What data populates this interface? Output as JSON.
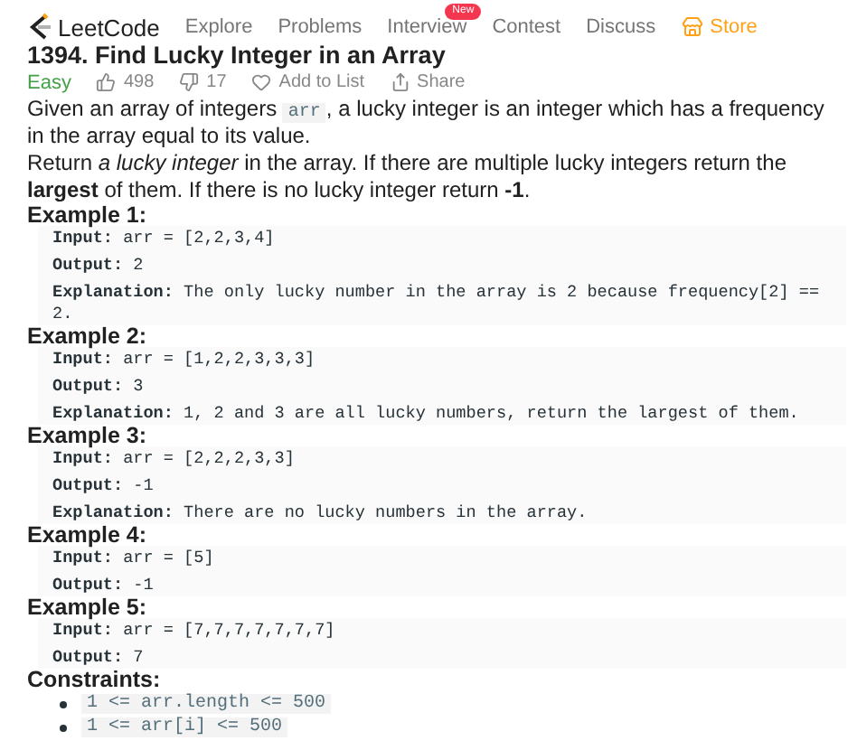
{
  "nav": {
    "logo": "LeetCode",
    "items": [
      {
        "label": "Explore",
        "kind": "link"
      },
      {
        "label": "Problems",
        "kind": "link"
      },
      {
        "label": "Interview",
        "kind": "link",
        "badge": "New"
      },
      {
        "label": "Contest",
        "kind": "link"
      },
      {
        "label": "Discuss",
        "kind": "link"
      },
      {
        "label": "Store",
        "kind": "store"
      }
    ]
  },
  "problem": {
    "title": "1394. Find Lucky Integer in an Array",
    "difficulty": "Easy",
    "likes": "498",
    "dislikes": "17",
    "add_to_list": "Add to List",
    "share": "Share"
  },
  "description": [
    [
      {
        "kind": "text",
        "text": "Given an array of integers "
      },
      {
        "kind": "code",
        "text": "arr"
      },
      {
        "kind": "text",
        "text": ", a lucky integer is an integer which has a frequency in the array equal to its value."
      }
    ],
    [
      {
        "kind": "text",
        "text": "Return *a lucky integer* in the array. If there are multiple lucky integers return the **largest** of them. If there is no lucky integer return **-1**."
      }
    ]
  ],
  "examples": [
    {
      "heading": "Example 1:",
      "lines": [
        {
          "label": "Input:",
          "value": "arr = [2,2,3,4]"
        },
        {
          "label": "Output:",
          "value": "2"
        },
        {
          "label": "Explanation:",
          "value": "The only lucky number in the array is 2 because frequency[2] == 2."
        }
      ]
    },
    {
      "heading": "Example 2:",
      "lines": [
        {
          "label": "Input:",
          "value": "arr = [1,2,2,3,3,3]"
        },
        {
          "label": "Output:",
          "value": "3"
        },
        {
          "label": "Explanation:",
          "value": "1, 2 and 3 are all lucky numbers, return the largest of them."
        }
      ]
    },
    {
      "heading": "Example 3:",
      "lines": [
        {
          "label": "Input:",
          "value": "arr = [2,2,2,3,3]"
        },
        {
          "label": "Output:",
          "value": "-1"
        },
        {
          "label": "Explanation:",
          "value": "There are no lucky numbers in the array."
        }
      ]
    },
    {
      "heading": "Example 4:",
      "lines": [
        {
          "label": "Input:",
          "value": "arr = [5]"
        },
        {
          "label": "Output:",
          "value": "-1"
        }
      ]
    },
    {
      "heading": "Example 5:",
      "lines": [
        {
          "label": "Input:",
          "value": "arr = [7,7,7,7,7,7,7]"
        },
        {
          "label": "Output:",
          "value": "7"
        }
      ]
    }
  ],
  "constraints": {
    "heading": "Constraints:",
    "items": [
      "1 <= arr.length <= 500",
      "1 <= arr[i] <= 500"
    ]
  }
}
